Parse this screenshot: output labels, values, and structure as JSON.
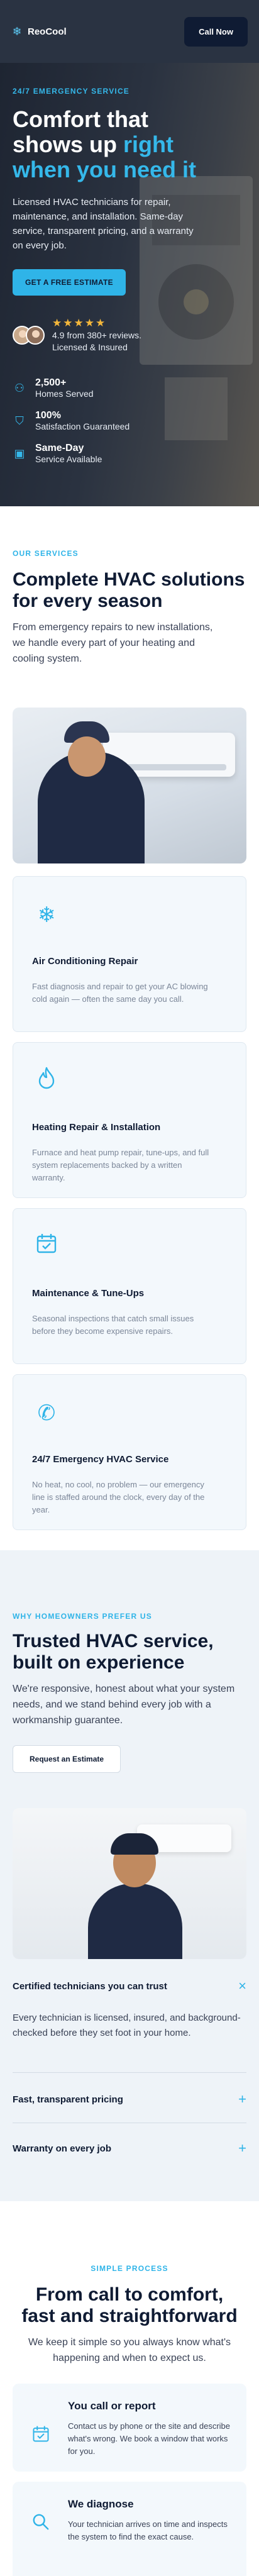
{
  "header": {
    "brand": "ReoCool",
    "brand_icon": "snowflake-icon",
    "call_button": "Call Now"
  },
  "hero": {
    "eyebrow": "24/7 EMERGENCY SERVICE",
    "title_line1": "Comfort that",
    "title_line2_plain": "shows up ",
    "title_line2_accent": "right",
    "title_line3": "when you need it",
    "description": "Licensed HVAC technicians for repair, maintenance, and installation. Same-day service, transparent pricing, and a warranty on every job.",
    "cta": "GET A FREE ESTIMATE",
    "stars": "★★★★★",
    "rating_line1": "4.9 from 380+ reviews.",
    "rating_line2": "Licensed & Insured",
    "stats": [
      {
        "icon": "users-icon",
        "value": "2,500+",
        "label": "Homes Served"
      },
      {
        "icon": "shield-check-icon",
        "value": "100%",
        "label": "Satisfaction Guaranteed"
      },
      {
        "icon": "calendar-icon",
        "value": "Same-Day",
        "label": "Service Available"
      }
    ]
  },
  "services": {
    "eyebrow": "OUR SERVICES",
    "title": "Complete HVAC solutions for every season",
    "description": "From emergency repairs to new installations, we handle every part of your heating and cooling system.",
    "cards": [
      {
        "icon": "snowflake-icon",
        "title": "Air Conditioning Repair",
        "description": "Fast diagnosis and repair to get your AC blowing cold again — often the same day you call."
      },
      {
        "icon": "flame-icon",
        "title": "Heating Repair & Installation",
        "description": "Furnace and heat pump repair, tune-ups, and full system replacements backed by a written warranty."
      },
      {
        "icon": "calendar-check-icon",
        "title": "Maintenance & Tune-Ups",
        "description": "Seasonal inspections that catch small issues before they become expensive repairs."
      },
      {
        "icon": "phone-icon",
        "title": "24/7 Emergency HVAC Service",
        "description": "No heat, no cool, no problem — our emergency line is staffed around the clock, every day of the year."
      }
    ]
  },
  "why": {
    "eyebrow": "WHY HOMEOWNERS PREFER US",
    "title": "Trusted HVAC service, built on experience",
    "description": "We're responsive, honest about what your system needs, and we stand behind every job with a workmanship guarantee.",
    "button": "Request an Estimate",
    "accordion": [
      {
        "title": "Certified technicians you can trust",
        "toggle": "×",
        "body": "Every technician is licensed, insured, and background-checked before they set foot in your home."
      },
      {
        "title": "Fast, transparent pricing",
        "toggle": "+"
      },
      {
        "title": "Warranty on every job",
        "toggle": "+"
      }
    ]
  },
  "process": {
    "eyebrow": "SIMPLE PROCESS",
    "title": "From call to comfort, fast and straightforward",
    "description": "We keep it simple so you always know what's happening and when to expect us.",
    "steps": [
      {
        "icon": "calendar-check-icon",
        "title": "You call or report",
        "description": "Contact us by phone or the site and describe what's wrong. We book a window that works for you."
      },
      {
        "icon": "search-icon",
        "title": "We diagnose",
        "description": "Your technician arrives on time and inspects the system to find the exact cause."
      }
    ]
  },
  "colors": {
    "accent": "#2fb4e8",
    "navy": "#0f1b33",
    "star": "#f4b73b"
  }
}
